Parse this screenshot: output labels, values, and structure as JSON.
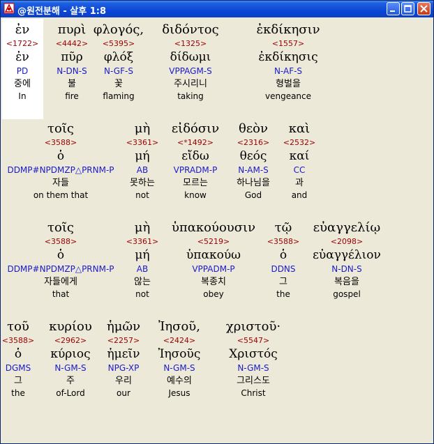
{
  "window": {
    "title": "@원전분해 - 살후 1:8"
  },
  "rows": [
    [
      {
        "greek": "ἐν",
        "strong": "<1722>",
        "lemma": "ἐν",
        "parse": "PD",
        "korean": "중에",
        "english": "In"
      },
      {
        "greek": "πυρὶ",
        "strong": "<4442>",
        "lemma": "πῦρ",
        "parse": "N-DN-S",
        "korean": "불",
        "english": "fire"
      },
      {
        "greek": "φλογός,",
        "strong": "<5395>",
        "lemma": "φλόξ",
        "parse": "N-GF-S",
        "korean": "꽃",
        "english": "flaming"
      },
      {
        "greek": "διδόντος",
        "strong": "<1325>",
        "lemma": "δίδωμι",
        "parse": "VPPAGM-S",
        "korean": "주시리니",
        "english": "taking"
      },
      {
        "greek": "ἐκδίκησιν",
        "strong": "<1557>",
        "lemma": "ἐκδίκησις",
        "parse": "N-AF-S",
        "korean": "형벌을",
        "english": "vengeance"
      }
    ],
    [
      {
        "greek": "τοῖς",
        "strong": "<3588>",
        "lemma": "ὁ",
        "parse": "DDMP#NPDMZP△PRNM-P",
        "korean": "자들",
        "english": "on them that"
      },
      {
        "greek": "μὴ",
        "strong": "<3361>",
        "lemma": "μή",
        "parse": "AB",
        "korean": "못하는",
        "english": "not"
      },
      {
        "greek": "εἰδόσιν",
        "strong": "<*1492>",
        "lemma": "εἴδω",
        "parse": "VPRADM-P",
        "korean": "모르는",
        "english": "know"
      },
      {
        "greek": "θεὸν",
        "strong": "<2316>",
        "lemma": "θεός",
        "parse": "N-AM-S",
        "korean": "하나님을",
        "english": "God"
      },
      {
        "greek": "καὶ",
        "strong": "<2532>",
        "lemma": "καί",
        "parse": "CC",
        "korean": "과",
        "english": "and"
      }
    ],
    [
      {
        "greek": "τοῖς",
        "strong": "<3588>",
        "lemma": "ὁ",
        "parse": "DDMP#NPDMZP△PRNM-P",
        "korean": "자들에게",
        "english": "that"
      },
      {
        "greek": "μὴ",
        "strong": "<3361>",
        "lemma": "μή",
        "parse": "AB",
        "korean": "않는",
        "english": "not"
      },
      {
        "greek": "ὑπακούουσιν",
        "strong": "<5219>",
        "lemma": "ὑπακούω",
        "parse": "VPPADM-P",
        "korean": "복종치",
        "english": "obey"
      },
      {
        "greek": "τῷ",
        "strong": "<3588>",
        "lemma": "ὁ",
        "parse": "DDNS",
        "korean": "그",
        "english": "the"
      },
      {
        "greek": "εὐαγγελίῳ",
        "strong": "<2098>",
        "lemma": "εὐαγγέλιον",
        "parse": "N-DN-S",
        "korean": "복음을",
        "english": "gospel"
      }
    ],
    [
      {
        "greek": "τοῦ",
        "strong": "<3588>",
        "lemma": "ὁ",
        "parse": "DGMS",
        "korean": "그",
        "english": "the"
      },
      {
        "greek": "κυρίου",
        "strong": "<2962>",
        "lemma": "κύριος",
        "parse": "N-GM-S",
        "korean": "주",
        "english": "of-Lord"
      },
      {
        "greek": "ἡμῶν",
        "strong": "<2257>",
        "lemma": "ἡμεῖν",
        "parse": "NPG-XP",
        "korean": "우리",
        "english": "our"
      },
      {
        "greek": "Ἰησοῦ,",
        "strong": "<2424>",
        "lemma": "Ἰησοῦς",
        "parse": "N-GM-S",
        "korean": "예수의",
        "english": "Jesus"
      },
      {
        "greek": "χριστοῦ·",
        "strong": "<5547>",
        "lemma": "Χριστός",
        "parse": "N-GM-S",
        "korean": "그리스도",
        "english": "Christ"
      }
    ]
  ]
}
